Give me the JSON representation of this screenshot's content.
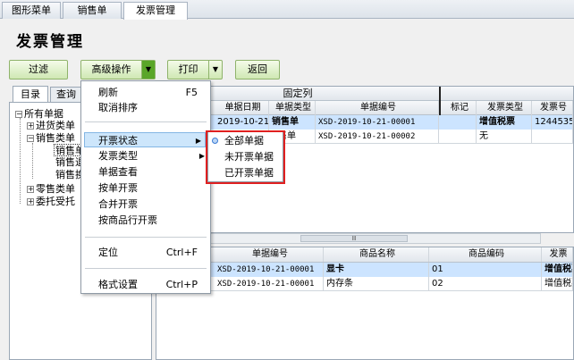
{
  "tabs": [
    "图形菜单",
    "销售单",
    "发票管理"
  ],
  "page_title": "发票管理",
  "toolbar": {
    "filter": "过滤",
    "advanced": "高级操作",
    "print": "打印",
    "back": "返回"
  },
  "left_tabs": [
    "目录",
    "查询"
  ],
  "tree": {
    "root": "所有单据",
    "items": [
      "进货类单",
      "销售类单",
      "销售单",
      "销售退",
      "销售换",
      "零售类单",
      "委托受托"
    ]
  },
  "top_grid": {
    "group_header": "固定列",
    "columns": [
      "单据日期",
      "单据类型",
      "单据编号",
      "标记",
      "发票类型",
      "发票号"
    ],
    "rows": [
      {
        "date": "2019-10-21",
        "type": "销售单",
        "no": "XSD-2019-10-21-00001",
        "mark": "",
        "inv_type": "增值税票",
        "inv_no": "1244535"
      },
      {
        "date": "",
        "type": "售单",
        "no": "XSD-2019-10-21-00002",
        "mark": "",
        "inv_type": "无",
        "inv_no": ""
      }
    ]
  },
  "scroll_marker": "Ⅲ",
  "bottom_grid": {
    "columns": [
      "单据编号",
      "商品名称",
      "商品编码",
      "发票"
    ],
    "rows": [
      {
        "no": "XSD-2019-10-21-00001",
        "name": "显卡",
        "code": "01",
        "inv": "增值税票"
      },
      {
        "no": "XSD-2019-10-21-00001",
        "name": "内存条",
        "code": "02",
        "inv": "增值税票"
      }
    ]
  },
  "context_menu": {
    "items": [
      {
        "label": "刷新",
        "shortcut": "F5"
      },
      {
        "label": "取消排序",
        "shortcut": ""
      },
      {
        "label": "开票状态",
        "shortcut": ""
      },
      {
        "label": "发票类型",
        "shortcut": ""
      },
      {
        "label": "单据查看",
        "shortcut": ""
      },
      {
        "label": "按单开票",
        "shortcut": ""
      },
      {
        "label": "合并开票",
        "shortcut": ""
      },
      {
        "label": "按商品行开票",
        "shortcut": ""
      },
      {
        "label": "定位",
        "shortcut": "Ctrl+F"
      },
      {
        "label": "格式设置",
        "shortcut": "Ctrl+P"
      }
    ]
  },
  "submenu": {
    "items": [
      "全部单据",
      "未开票单据",
      "已开票单据"
    ],
    "selected": "全部单据"
  }
}
